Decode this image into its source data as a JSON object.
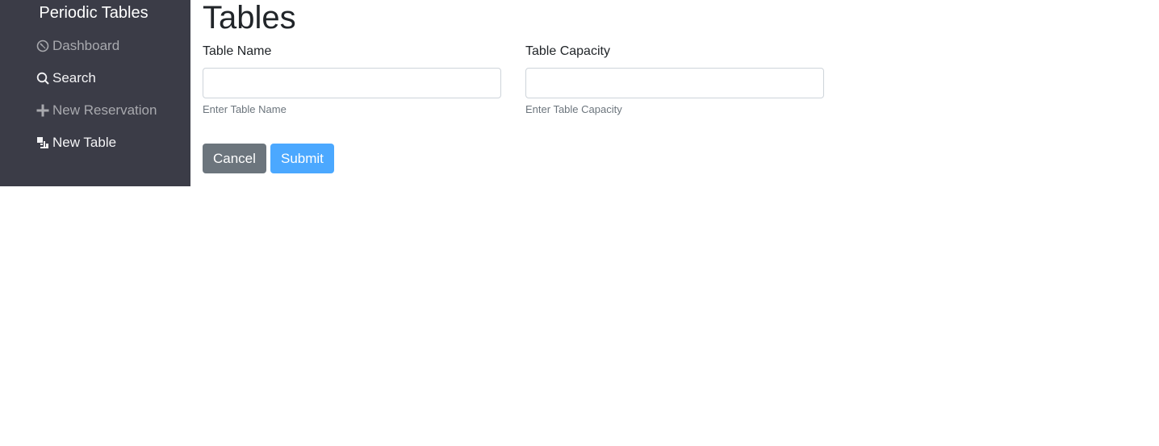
{
  "sidebar": {
    "brand": "Periodic Tables",
    "items": [
      {
        "label": "Dashboard",
        "icon": "dashboard-icon"
      },
      {
        "label": "Search",
        "icon": "search-icon"
      },
      {
        "label": "New Reservation",
        "icon": "plus-icon"
      },
      {
        "label": "New Table",
        "icon": "new-table-icon"
      }
    ]
  },
  "main": {
    "title": "Tables",
    "form": {
      "table_name": {
        "label": "Table Name",
        "value": "",
        "help": "Enter Table Name"
      },
      "table_capacity": {
        "label": "Table Capacity",
        "value": "",
        "help": "Enter Table Capacity"
      },
      "cancel_label": "Cancel",
      "submit_label": "Submit"
    }
  },
  "colors": {
    "sidebar_bg": "#3b3c47",
    "cancel_button": "#6c757d",
    "submit_button": "#4ba8ff"
  }
}
